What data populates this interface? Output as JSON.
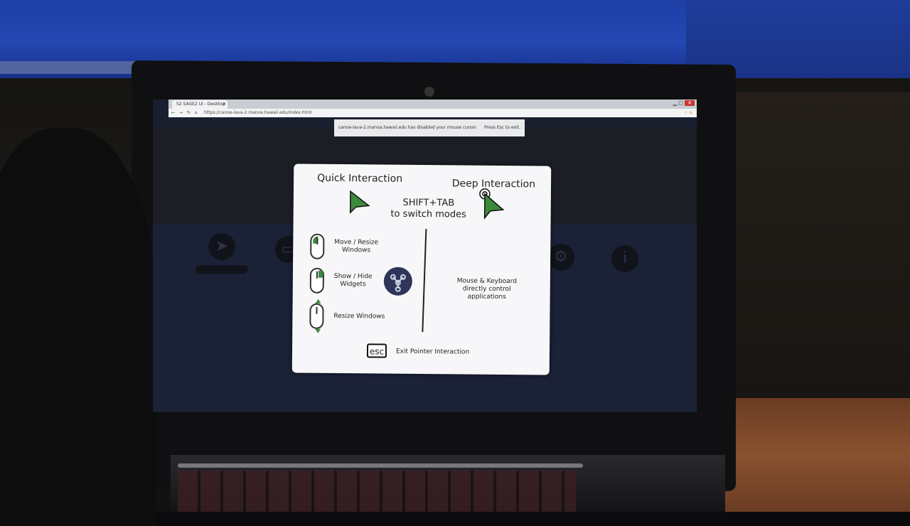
{
  "browser": {
    "tab_title": "S2 SAGE2 UI - Desktop",
    "url": "https://canoe-lava-2.manoa.hawaii.edu/index.html",
    "notification": "canoe-lava-2.manoa.hawaii.edu has disabled your mouse cursor.",
    "notification_hint": "Press Esc to exit."
  },
  "dialog": {
    "quick_title": "Quick Interaction",
    "deep_title": "Deep Interaction",
    "switch_line1": "SHIFT+TAB",
    "switch_line2": "to switch modes",
    "rows": [
      {
        "label": "Move / Resize\nWindows"
      },
      {
        "label": "Show / Hide\nWidgets"
      },
      {
        "label": "Resize Windows"
      }
    ],
    "deep_desc": "Mouse & Keyboard\ndirectly control\napplications",
    "esc_key": "esc",
    "esc_label": "Exit Pointer Interaction"
  },
  "colors": {
    "accent_green": "#3c8a3c",
    "widget_circle": "#2f3558",
    "wall_blue": "#2447b2"
  }
}
